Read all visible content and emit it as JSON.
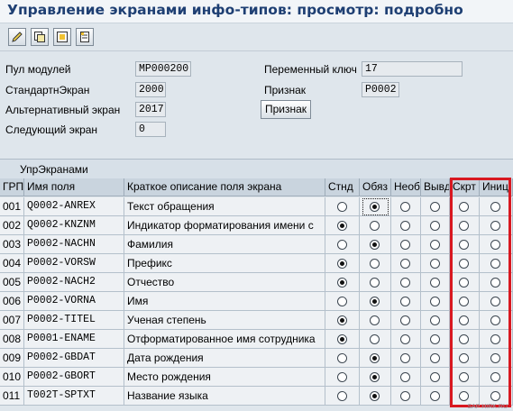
{
  "title": "Управление экранами инфо-типов: просмотр: подробно",
  "toolbar": {
    "icons": [
      "edit-pencil-icon",
      "copy-icon",
      "display-icon",
      "document-icon"
    ]
  },
  "header_fields": {
    "module_pool_label": "Пул модулей",
    "module_pool_value": "MP000200",
    "standard_screen_label": "СтандартнЭкран",
    "standard_screen_value": "2000",
    "alt_screen_label": "Альтернативный экран",
    "alt_screen_value": "2017",
    "next_screen_label": "Следующий экран",
    "next_screen_value": "0",
    "variable_key_label": "Переменный ключ",
    "variable_key_value": "17",
    "feature_label": "Признак",
    "feature_value": "P0002",
    "feature_button": "Признак"
  },
  "table": {
    "caption": "УпрЭкранами",
    "columns": [
      "ГРП",
      "Имя поля",
      "Краткое описание поля экрана",
      "Стнд",
      "Обяз",
      "Необ",
      "Вывд",
      "Скрт",
      "Иниц"
    ],
    "rows": [
      {
        "grp": "001",
        "field": "Q0002-ANREX",
        "desc": "Текст обращения",
        "sel": 1
      },
      {
        "grp": "002",
        "field": "Q0002-KNZNM",
        "desc": "Индикатор форматирования имени с",
        "sel": 0
      },
      {
        "grp": "003",
        "field": "P0002-NACHN",
        "desc": "Фамилия",
        "sel": 1
      },
      {
        "grp": "004",
        "field": "P0002-VORSW",
        "desc": "Префикс",
        "sel": 0
      },
      {
        "grp": "005",
        "field": "P0002-NACH2",
        "desc": "Отчество",
        "sel": 0
      },
      {
        "grp": "006",
        "field": "P0002-VORNA",
        "desc": "Имя",
        "sel": 1
      },
      {
        "grp": "007",
        "field": "P0002-TITEL",
        "desc": "Ученая степень",
        "sel": 0
      },
      {
        "grp": "008",
        "field": "P0001-ENAME",
        "desc": "Отформатированное имя сотрудника",
        "sel": 0
      },
      {
        "grp": "009",
        "field": "P0002-GBDAT",
        "desc": "Дата рождения",
        "sel": 1
      },
      {
        "grp": "010",
        "field": "P0002-GBORT",
        "desc": "Место рождения",
        "sel": 1
      },
      {
        "grp": "011",
        "field": "T002T-SPTXT",
        "desc": "Название языка",
        "sel": 1
      }
    ]
  },
  "watermark": "SAP HIRK.RU",
  "colors": {
    "title": "#1e3f73",
    "highlight": "#d81820",
    "background": "#dfe6ec"
  }
}
